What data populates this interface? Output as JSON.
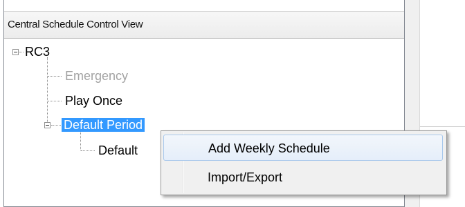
{
  "panel": {
    "title": "Central Schedule Control View"
  },
  "tree": {
    "root": {
      "label": "RC3"
    },
    "children": [
      {
        "label": "Emergency",
        "state": "disabled"
      },
      {
        "label": "Play Once",
        "state": "normal"
      },
      {
        "label": "Default Period",
        "state": "selected"
      }
    ],
    "grandchildren": [
      {
        "label": "Default"
      }
    ]
  },
  "context_menu": {
    "items": [
      {
        "label": "Add Weekly Schedule",
        "state": "hover"
      },
      {
        "label": "Import/Export"
      }
    ]
  },
  "colors": {
    "selection": "#3399ff",
    "disabled_text": "#a3a3a3",
    "menu_background": "#f0f0f0",
    "menu_hover_border": "#a8c8ec"
  }
}
